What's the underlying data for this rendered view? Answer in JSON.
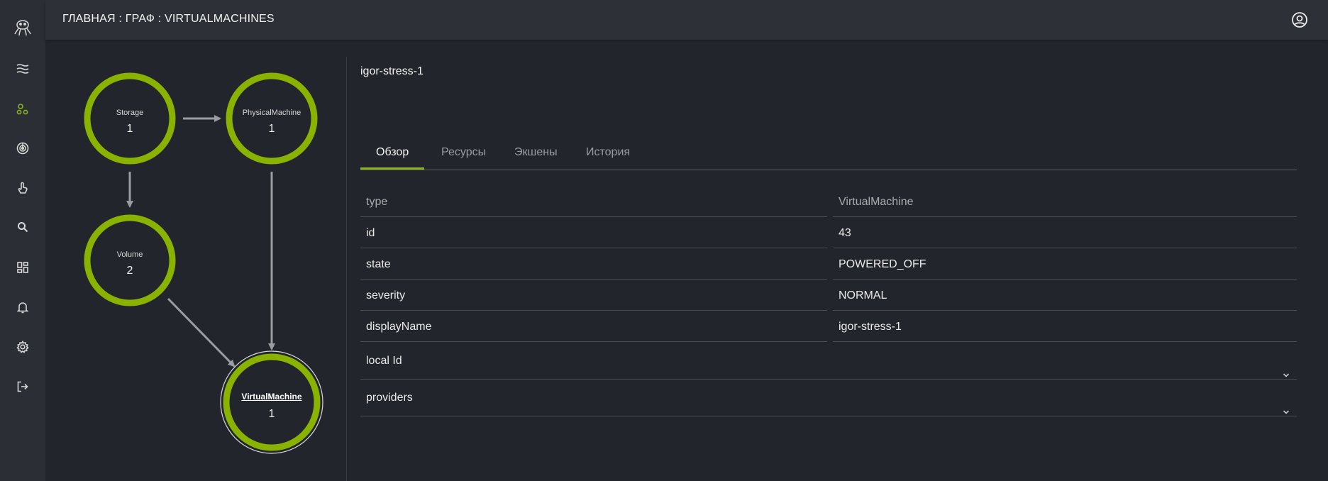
{
  "header": {
    "breadcrumb": "ГЛАВНАЯ : ГРАФ : VIRTUALMACHINES"
  },
  "sidebar": {
    "items": [
      {
        "icon": "octopus-logo-icon"
      },
      {
        "icon": "layers-icon"
      },
      {
        "icon": "graph-icon",
        "active": true
      },
      {
        "icon": "radar-icon"
      },
      {
        "icon": "touch-icon"
      },
      {
        "icon": "search-icon"
      },
      {
        "icon": "dashboard-icon"
      },
      {
        "icon": "bell-icon"
      },
      {
        "icon": "gear-icon"
      },
      {
        "icon": "logout-icon"
      }
    ],
    "active_color": "#8bb31d"
  },
  "graph": {
    "node_color": "#8ab200",
    "edge_color": "#9a9ca1",
    "nodes": [
      {
        "type": "Storage",
        "count": "1"
      },
      {
        "type": "PhysicalMachine",
        "count": "1"
      },
      {
        "type": "Volume",
        "count": "2"
      },
      {
        "type": "VirtualMachine",
        "count": "1",
        "selected": true
      }
    ]
  },
  "details": {
    "title": "igor-stress-1",
    "tabs": [
      {
        "label": "Обзор",
        "active": true
      },
      {
        "label": "Ресурсы"
      },
      {
        "label": "Экшены"
      },
      {
        "label": "История"
      }
    ],
    "rows": [
      {
        "key": "type",
        "value": "VirtualMachine"
      },
      {
        "key": "id",
        "value": "43"
      },
      {
        "key": "state",
        "value": "POWERED_OFF"
      },
      {
        "key": "severity",
        "value": "NORMAL"
      },
      {
        "key": "displayName",
        "value": "igor-stress-1"
      }
    ],
    "expandable": [
      {
        "label": "local Id"
      },
      {
        "label": "providers"
      }
    ]
  }
}
